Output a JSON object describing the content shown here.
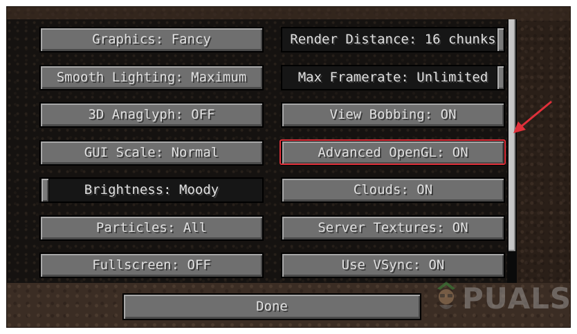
{
  "options": {
    "left_column": [
      {
        "label": "Graphics: Fancy"
      },
      {
        "label": "Smooth Lighting: Maximum"
      },
      {
        "label": "3D Anaglyph: OFF"
      },
      {
        "label": "GUI Scale: Normal"
      },
      {
        "label": "Brightness: Moody",
        "slider_value": 0.0
      },
      {
        "label": "Particles: All"
      },
      {
        "label": "Fullscreen: OFF"
      }
    ],
    "right_column": [
      {
        "label": "Render Distance: 16 chunks",
        "slider_value": 1.0
      },
      {
        "label": "Max Framerate: Unlimited",
        "slider_value": 1.0
      },
      {
        "label": "View Bobbing: ON"
      },
      {
        "label": "Advanced OpenGL: ON",
        "highlighted": true
      },
      {
        "label": "Clouds: ON"
      },
      {
        "label": "Server Textures: ON"
      },
      {
        "label": "Use VSync: ON"
      }
    ]
  },
  "done_button": {
    "label": "Done"
  },
  "watermark": {
    "text": "PUALS"
  },
  "colors": {
    "highlight": "#e0303a",
    "button": "#6f6f6f",
    "text": "#e0e0e0"
  }
}
